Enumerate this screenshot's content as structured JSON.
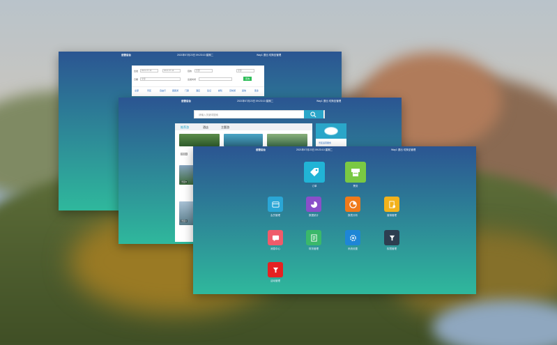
{
  "windows": {
    "w1": {
      "brand": "运营后台",
      "datetime": "2021年07月23日 09:23:10 星期二",
      "user": "Way1  退出  切换至管理",
      "form_labels": [
        "出发",
        "目的",
        "日期",
        "出发时间"
      ],
      "inputs": [
        "2021-07-16",
        "2021-07-16",
        "全部",
        "全部",
        "全部"
      ],
      "search_button": "查询",
      "tabs": [
        "全部",
        "景区",
        "自由行",
        "跟团游",
        "门票",
        "酒店",
        "签证",
        "邮轮",
        "定制游",
        "其他",
        "更多"
      ]
    },
    "w2": {
      "brand": "运营后台",
      "datetime": "2021年07月23日 09:23:10 星期二",
      "user": "Way1  退出  切换至管理",
      "search_placeholder": "请输入关键词搜索",
      "tabs": [
        "推荐游",
        "酒店",
        "主题游"
      ],
      "captions": [
        "景区A",
        "景区B",
        "景区C"
      ],
      "side_logo": "旅游网",
      "side_text": "景区运营服务"
    },
    "w3": {
      "brand": "运营后台",
      "datetime": "2021年07月23日 09:23:10 星期二",
      "user": "Way1  退出  切换至管理",
      "apps_big": [
        {
          "label": "订单",
          "color": "#21b4d6",
          "icon": "tag-icon"
        },
        {
          "label": "票务",
          "color": "#7ac943",
          "icon": "ticket-printer-icon"
        }
      ],
      "apps_small": [
        {
          "label": "会员管理",
          "color": "#2aa6d6",
          "icon": "card-icon"
        },
        {
          "label": "数据统计",
          "color": "#8a4fc9",
          "icon": "pie-chart-icon"
        },
        {
          "label": "报表分析",
          "color": "#ef7a1a",
          "icon": "pie-icon"
        },
        {
          "label": "营销管理",
          "color": "#f2b21b",
          "icon": "document-icon"
        },
        {
          "label": "消息中心",
          "color": "#ef5b6a",
          "icon": "message-icon"
        },
        {
          "label": "财务管理",
          "color": "#3ab86a",
          "icon": "ledger-icon"
        },
        {
          "label": "系统设置",
          "color": "#1e86d6",
          "icon": "gear-icon"
        },
        {
          "label": "权限管理",
          "color": "#2d3e50",
          "icon": "cup-icon"
        },
        {
          "label": "活动管理",
          "color": "#e52222",
          "icon": "cup-icon"
        }
      ]
    }
  }
}
